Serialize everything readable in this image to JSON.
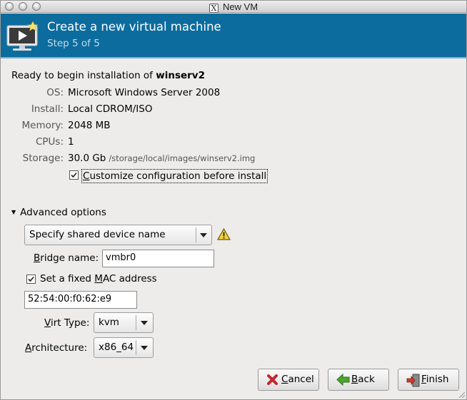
{
  "window": {
    "title": "New VM"
  },
  "header": {
    "title": "Create a new virtual machine",
    "step": "Step 5 of 5"
  },
  "summary": {
    "ready_prefix": "Ready to begin installation of ",
    "vm_name": "winserv2",
    "os_label": "OS:",
    "os_value": "Microsoft Windows Server 2008",
    "install_label": "Install:",
    "install_value": "Local CDROM/ISO",
    "memory_label": "Memory:",
    "memory_value": "2048 MB",
    "cpus_label": "CPUs:",
    "cpus_value": "1",
    "storage_label": "Storage:",
    "storage_value": "30.0 Gb",
    "storage_path": "/storage/local/images/winserv2.img",
    "customize_label_u": "C",
    "customize_label_rest": "ustomize configuration before install",
    "customize_checked": true
  },
  "advanced": {
    "label": "Advanced options",
    "device_select": "Specify shared device name",
    "bridge_label_u": "B",
    "bridge_label_rest": "ridge name:",
    "bridge_value": "vmbr0",
    "mac_label_pre": "Set a fixed ",
    "mac_label_u": "M",
    "mac_label_post": "AC address",
    "mac_checked": true,
    "mac_value": "52:54:00:f0:62:e9",
    "virt_label_u": "V",
    "virt_label_rest": "irt Type:",
    "virt_value": "kvm",
    "arch_label_u": "A",
    "arch_label_rest": "rchitecture:",
    "arch_value": "x86_64"
  },
  "buttons": {
    "cancel_u": "C",
    "cancel_rest": "ancel",
    "back_u": "B",
    "back_rest": "ack",
    "finish_u": "F",
    "finish_rest": "inish"
  },
  "colors": {
    "header_bg": "#0c6c9e",
    "window_bg": "#edeceb"
  }
}
